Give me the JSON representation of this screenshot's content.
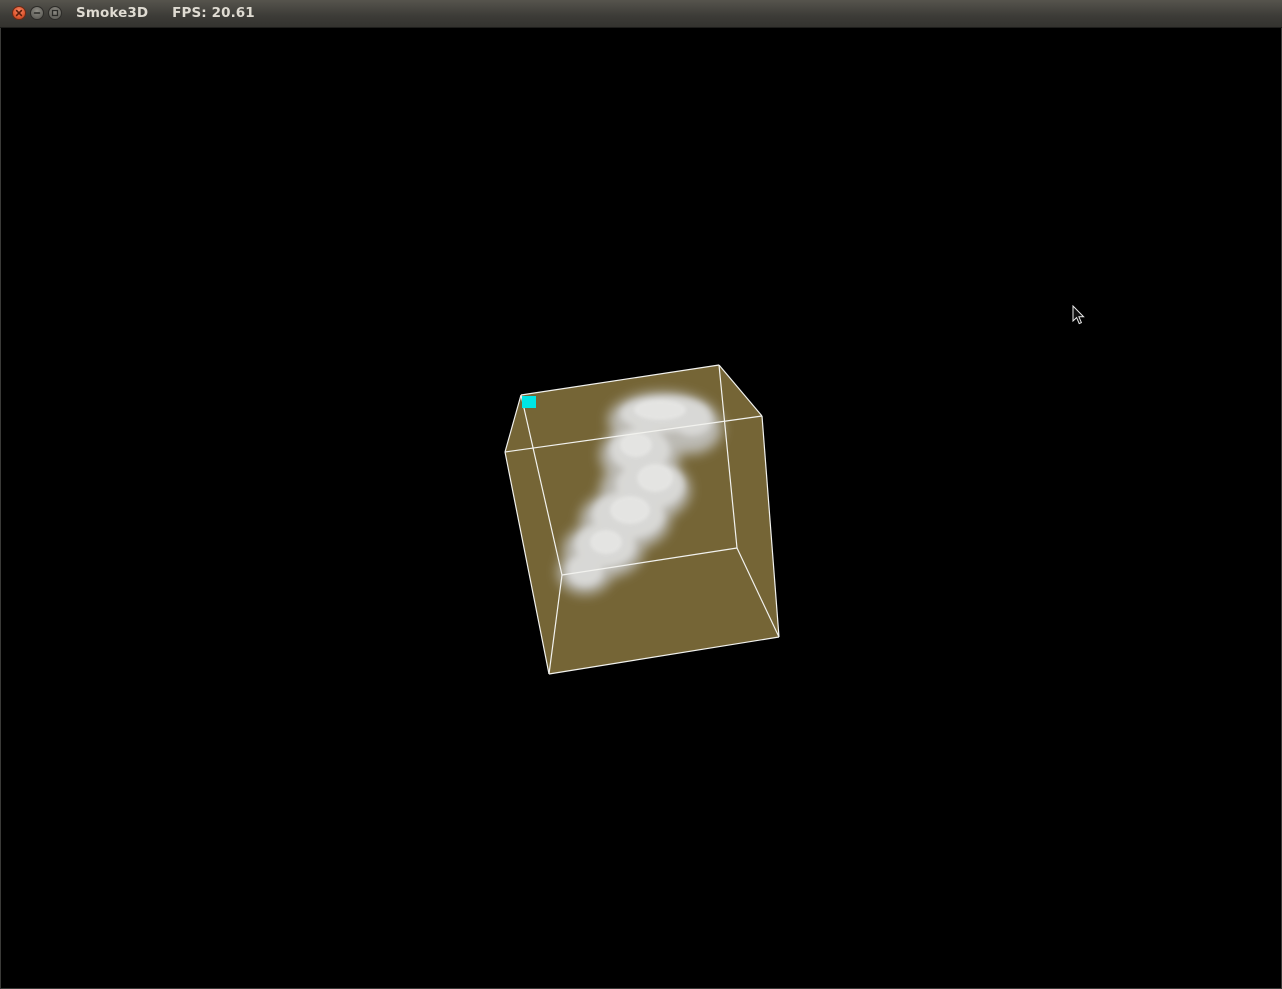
{
  "window": {
    "app_name": "Smoke3D",
    "fps_text": "FPS: 20.61"
  },
  "colors": {
    "titlebar": "#3c3b37",
    "background": "#000000",
    "volume_box": "#756536",
    "wireframe": "#ffffff",
    "marker": "#00e5e5",
    "smoke": "#d8d8d8",
    "close_button": "#e05a32"
  },
  "icons": {
    "close": "close-icon",
    "minimize": "minimize-icon",
    "maximize": "maximize-icon",
    "cursor": "mouse-pointer-icon"
  }
}
